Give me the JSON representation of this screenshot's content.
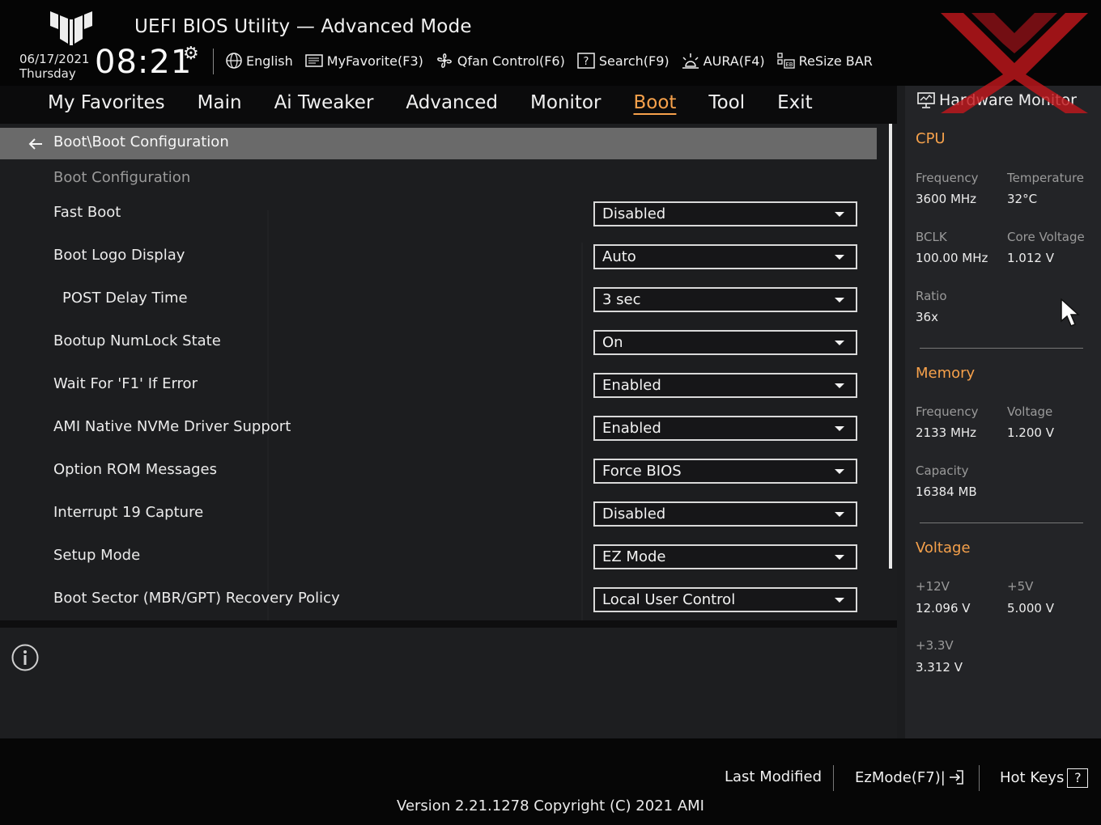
{
  "header": {
    "title": "UEFI BIOS Utility — Advanced Mode",
    "date": "06/17/2021",
    "day": "Thursday",
    "time": "08:21",
    "toolbar": [
      {
        "label": "English",
        "icon": "globe-icon"
      },
      {
        "label": "MyFavorite(F3)",
        "icon": "favorite-list-icon"
      },
      {
        "label": "Qfan Control(F6)",
        "icon": "fan-icon"
      },
      {
        "label": "Search(F9)",
        "icon": "search-help-icon"
      },
      {
        "label": "AURA(F4)",
        "icon": "aura-light-icon"
      },
      {
        "label": "ReSize BAR",
        "icon": "resize-bar-icon"
      }
    ]
  },
  "tabs": [
    {
      "label": "My Favorites"
    },
    {
      "label": "Main"
    },
    {
      "label": "Ai Tweaker"
    },
    {
      "label": "Advanced"
    },
    {
      "label": "Monitor"
    },
    {
      "label": "Boot",
      "active": true
    },
    {
      "label": "Tool"
    },
    {
      "label": "Exit"
    }
  ],
  "main": {
    "breadcrumb": "Boot\\Boot Configuration",
    "section_title": "Boot Configuration",
    "settings": [
      {
        "label": "Fast Boot",
        "value": "Disabled"
      },
      {
        "label": "Boot Logo Display",
        "value": "Auto"
      },
      {
        "label": "POST Delay Time",
        "value": "3 sec"
      },
      {
        "label": "Bootup NumLock State",
        "value": "On"
      },
      {
        "label": "Wait For 'F1' If Error",
        "value": "Enabled"
      },
      {
        "label": "AMI Native NVMe Driver Support",
        "value": "Enabled"
      },
      {
        "label": "Option ROM Messages",
        "value": "Force BIOS"
      },
      {
        "label": "Interrupt 19 Capture",
        "value": "Disabled"
      },
      {
        "label": "Setup Mode",
        "value": "EZ Mode"
      },
      {
        "label": "Boot Sector (MBR/GPT) Recovery Policy",
        "value": "Local User Control"
      }
    ]
  },
  "hw_monitor": {
    "title": "Hardware Monitor",
    "cpu": {
      "heading": "CPU",
      "frequency_label": "Frequency",
      "frequency": "3600 MHz",
      "temperature_label": "Temperature",
      "temperature": "32°C",
      "bclk_label": "BCLK",
      "bclk": "100.00 MHz",
      "core_voltage_label": "Core Voltage",
      "core_voltage": "1.012 V",
      "ratio_label": "Ratio",
      "ratio": "36x"
    },
    "memory": {
      "heading": "Memory",
      "frequency_label": "Frequency",
      "frequency": "2133 MHz",
      "voltage_label": "Voltage",
      "voltage": "1.200 V",
      "capacity_label": "Capacity",
      "capacity": "16384 MB"
    },
    "voltage": {
      "heading": "Voltage",
      "v12_label": "+12V",
      "v12": "12.096 V",
      "v5_label": "+5V",
      "v5": "5.000 V",
      "v33_label": "+3.3V",
      "v33": "3.312 V"
    }
  },
  "footer": {
    "last_modified": "Last Modified",
    "ezmode": "EzMode(F7)|",
    "hotkeys": "Hot Keys",
    "hotkeys_key": "?",
    "version": "Version 2.21.1278 Copyright (C) 2021 AMI"
  },
  "colors": {
    "accent": "#f6a14b",
    "watermark": "#c0171c"
  }
}
